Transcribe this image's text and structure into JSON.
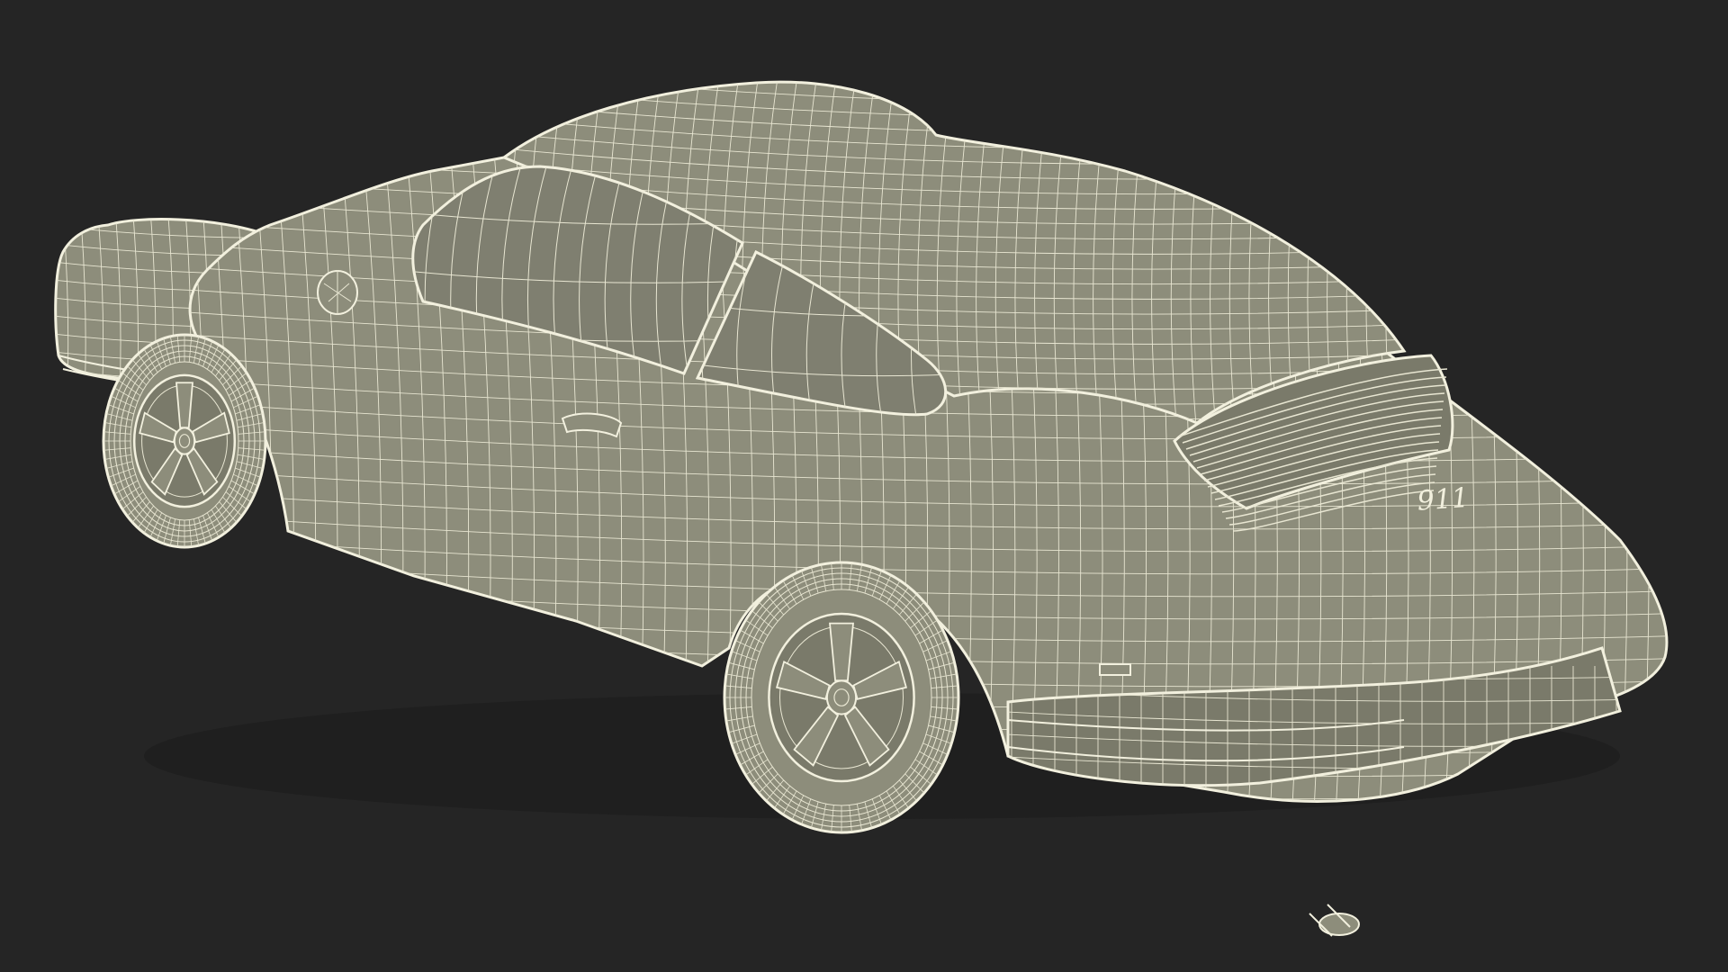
{
  "scene": {
    "subject": "car-wireframe-render",
    "background_color": "#252525",
    "body_fill_color": "#8d8d7b",
    "body_shade_color": "#7a7a6a",
    "glass_fill_color": "#7f7f70",
    "wire_color": "#e8e6d2",
    "outline_color": "#f2f0de",
    "rear_badge_text": "911"
  }
}
